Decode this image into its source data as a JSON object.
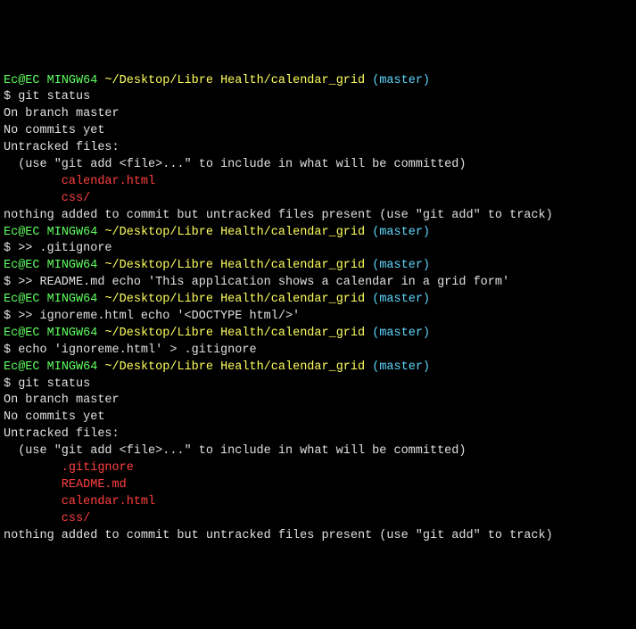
{
  "blocks": [
    {
      "prompt": {
        "user": "Ec@EC",
        "env": "MINGW64",
        "path": "~/Desktop/Libre Health/calendar_grid",
        "branch": "(master)"
      },
      "cmd": "$ git status",
      "output_pre": [
        "On branch master",
        "",
        "No commits yet",
        "",
        "Untracked files:",
        "  (use \"git add <file>...\" to include in what will be committed)",
        ""
      ],
      "untracked": [
        "        calendar.html",
        "        css/"
      ],
      "output_post": [
        "",
        "nothing added to commit but untracked files present (use \"git add\" to track)",
        ""
      ]
    },
    {
      "prompt": {
        "user": "Ec@EC",
        "env": "MINGW64",
        "path": "~/Desktop/Libre Health/calendar_grid",
        "branch": "(master)"
      },
      "cmd": "$ >> .gitignore",
      "output_pre": [
        ""
      ],
      "untracked": [],
      "output_post": []
    },
    {
      "prompt": {
        "user": "Ec@EC",
        "env": "MINGW64",
        "path": "~/Desktop/Libre Health/calendar_grid",
        "branch": "(master)"
      },
      "cmd": "$ >> README.md echo 'This application shows a calendar in a grid form'",
      "output_pre": [
        ""
      ],
      "untracked": [],
      "output_post": []
    },
    {
      "prompt": {
        "user": "Ec@EC",
        "env": "MINGW64",
        "path": "~/Desktop/Libre Health/calendar_grid",
        "branch": "(master)"
      },
      "cmd": "$ >> ignoreme.html echo '<DOCTYPE html/>'",
      "output_pre": [
        ""
      ],
      "untracked": [],
      "output_post": []
    },
    {
      "prompt": {
        "user": "Ec@EC",
        "env": "MINGW64",
        "path": "~/Desktop/Libre Health/calendar_grid",
        "branch": "(master)"
      },
      "cmd": "$ echo 'ignoreme.html' > .gitignore",
      "output_pre": [
        ""
      ],
      "untracked": [],
      "output_post": []
    },
    {
      "prompt": {
        "user": "Ec@EC",
        "env": "MINGW64",
        "path": "~/Desktop/Libre Health/calendar_grid",
        "branch": "(master)"
      },
      "cmd": "$ git status",
      "output_pre": [
        "On branch master",
        "",
        "No commits yet",
        "",
        "Untracked files:",
        "  (use \"git add <file>...\" to include in what will be committed)",
        ""
      ],
      "untracked": [
        "        .gitignore",
        "        README.md",
        "        calendar.html",
        "        css/"
      ],
      "output_post": [
        "",
        "nothing added to commit but untracked files present (use \"git add\" to track)"
      ]
    }
  ]
}
